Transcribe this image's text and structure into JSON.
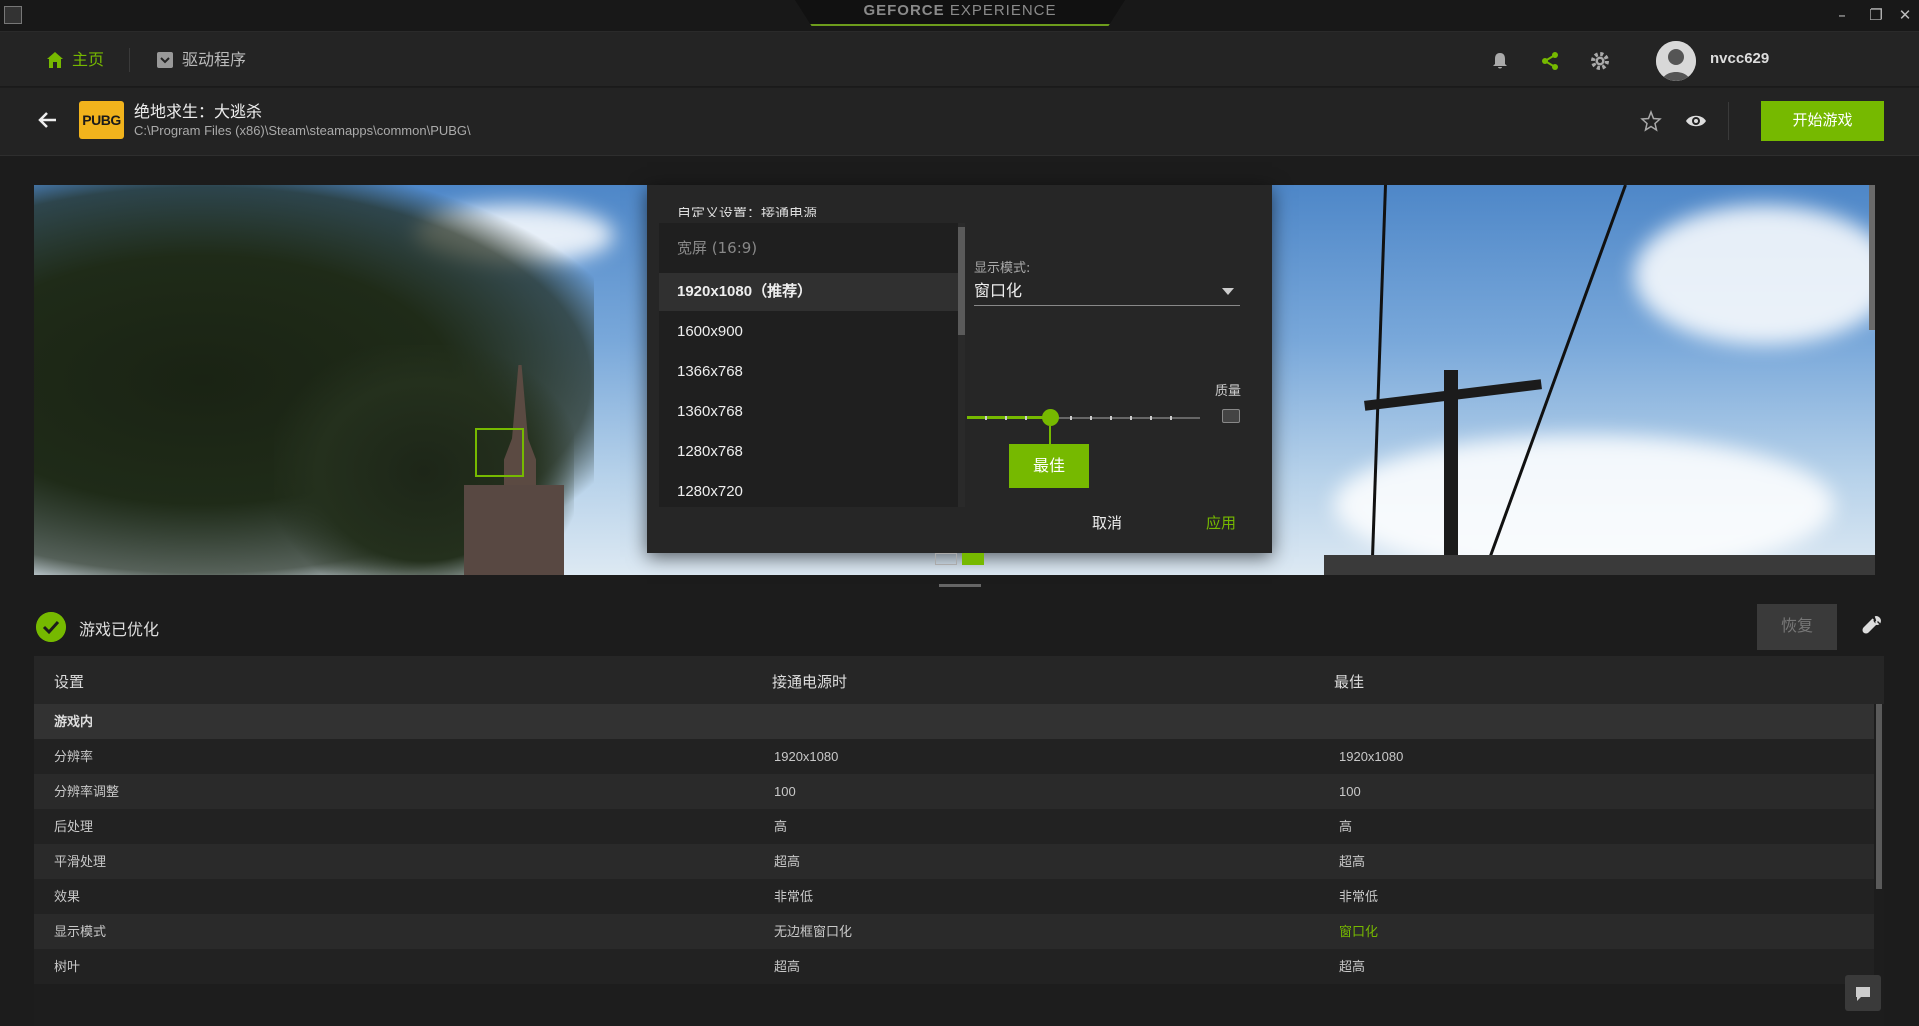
{
  "titlebar": {
    "brand_bold": "GEFORCE",
    "brand_light": " EXPERIENCE",
    "minimize": "–",
    "maximize": "❐",
    "close": "✕"
  },
  "nav": {
    "home_label": "主页",
    "drivers_label": "驱动程序",
    "username": "nvcc629"
  },
  "game": {
    "logo_text": "PUBG",
    "title": "绝地求生：大逃杀",
    "path": "C:\\Program Files (x86)\\Steam\\steamapps\\common\\PUBG\\",
    "launch_label": "开始游戏"
  },
  "overlay": {
    "title": "自定义设置：接通电源",
    "res_group_header": "宽屏 (16:9)",
    "resolutions": [
      "1920x1080（推荐）",
      "1600x900",
      "1366x768",
      "1360x768",
      "1280x768",
      "1280x720"
    ],
    "selected_index": 0,
    "display_mode_label": "显示模式:",
    "display_mode_value": "窗口化",
    "quality_label": "质量",
    "quality_level": 0.35,
    "best_label": "最佳",
    "cancel_label": "取消",
    "apply_label": "应用"
  },
  "optimized": {
    "label": "游戏已优化",
    "restore_label": "恢复"
  },
  "table": {
    "headers": [
      "设置",
      "接通电源时",
      "最佳"
    ],
    "section": "游戏内",
    "rows": [
      {
        "setting": "分辨率",
        "current": "1920x1080",
        "best": "1920x1080",
        "highlight": false
      },
      {
        "setting": "分辨率调整",
        "current": "100",
        "best": "100",
        "highlight": false
      },
      {
        "setting": "后处理",
        "current": "高",
        "best": "高",
        "highlight": false
      },
      {
        "setting": "平滑处理",
        "current": "超高",
        "best": "超高",
        "highlight": false
      },
      {
        "setting": "效果",
        "current": "非常低",
        "best": "非常低",
        "highlight": false
      },
      {
        "setting": "显示模式",
        "current": "无边框窗口化",
        "best": "窗口化",
        "highlight": true
      },
      {
        "setting": "树叶",
        "current": "超高",
        "best": "超高",
        "highlight": false
      }
    ]
  },
  "colors": {
    "accent": "#76b900",
    "background": "#1c1c1c"
  }
}
